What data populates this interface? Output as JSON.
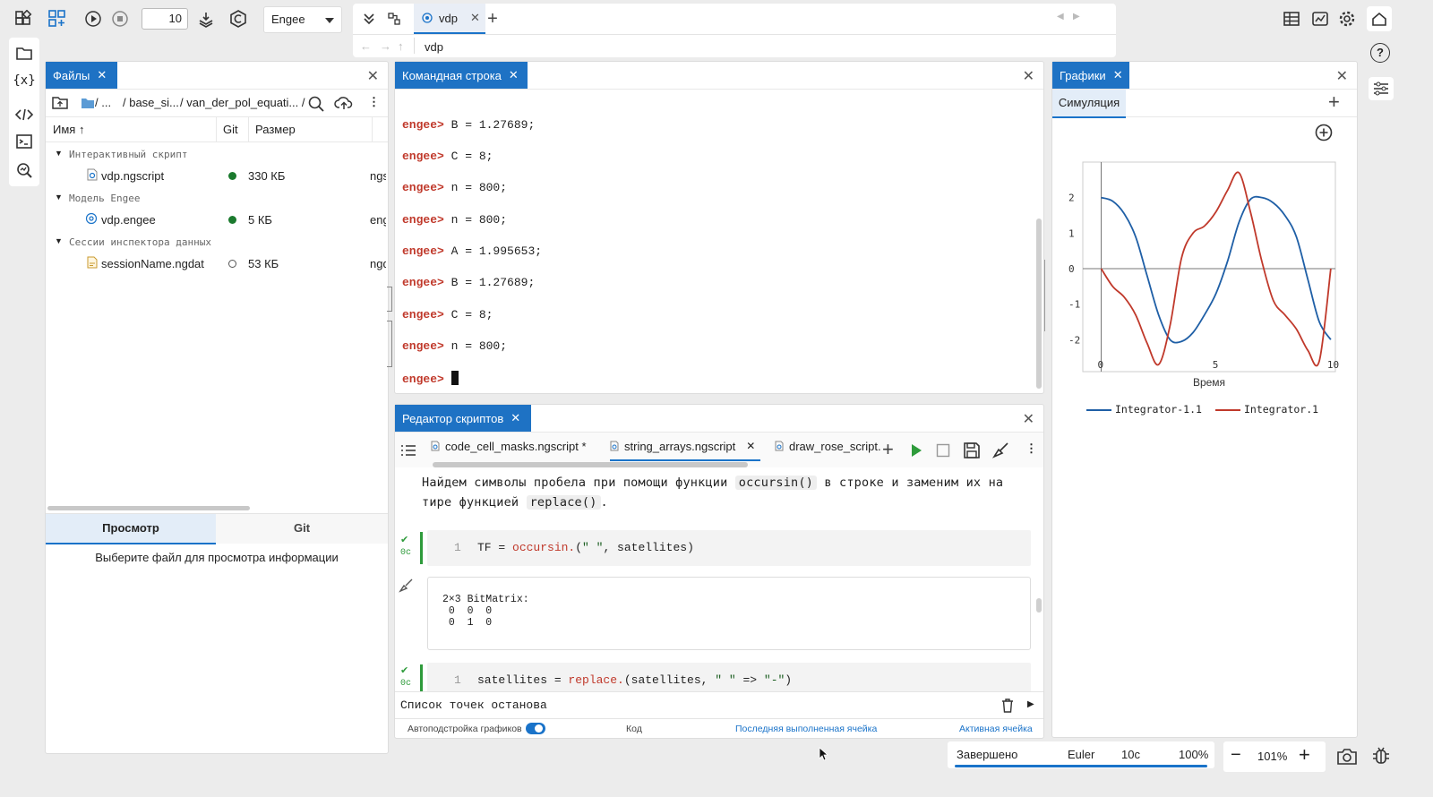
{
  "toolbar": {
    "step_value": "10",
    "engine": "Engee",
    "doc_tab": "vdp",
    "address": "vdp"
  },
  "files": {
    "tab_label": "Файлы",
    "breadcrumb": [
      "/ ...",
      "/ base_si...",
      "/ van_der_pol_equati... /"
    ],
    "columns": {
      "name": "Имя",
      "git": "Git",
      "size": "Размер"
    },
    "groups": [
      {
        "label": "Интерактивный скрипт",
        "items": [
          {
            "name": "vdp.ngscript",
            "git": "dot",
            "size": "330 КБ",
            "type": "ngs"
          }
        ]
      },
      {
        "label": "Модель Engee",
        "items": [
          {
            "name": "vdp.engee",
            "git": "dot",
            "size": "5 КБ",
            "type": "eng"
          }
        ]
      },
      {
        "label": "Сессии инспектора данных",
        "items": [
          {
            "name": "sessionName.ngdat",
            "git": "ring",
            "size": "53 КБ",
            "type": "ngd"
          }
        ]
      }
    ],
    "preview_tabs": [
      "Просмотр",
      "Git"
    ],
    "preview_hint": "Выберите файл для просмотра информации"
  },
  "console": {
    "tab_label": "Командная строка",
    "prompt": "engee>",
    "lines": [
      "B = 1.27689;",
      "C = 8;",
      "n = 800;",
      "n = 800;",
      "A = 1.995653;",
      "B = 1.27689;",
      "C = 8;",
      "n = 800;",
      ""
    ]
  },
  "editor": {
    "tab_label": "Редактор скриптов",
    "file_tabs": [
      "code_cell_masks.ngscript *",
      "string_arrays.ngscript",
      "draw_rose_script.n"
    ],
    "text_parts": [
      "Найдем символы пробела при помощи функции",
      "occursin()",
      "в строке и заменим их на тире",
      "функцией",
      "replace()",
      "."
    ],
    "cell1": {
      "time": "0с",
      "line_no": "1",
      "code_plain1": "TF = ",
      "code_fn": "occursin.",
      "code_plain2": "(",
      "code_str": "\" \"",
      "code_plain3": ", satellites)"
    },
    "output": [
      "2×3 BitMatrix:",
      " 0  0  0",
      " 0  1  0"
    ],
    "cell2": {
      "time": "0с",
      "line_no": "1",
      "code_plain1": "satellites = ",
      "code_fn": "replace.",
      "code_plain2": "(satellites, ",
      "code_str1": "\" \"",
      "code_arrow": " => ",
      "code_str2": "\"-\"",
      "code_plain3": ")"
    },
    "breakpoints_label": "Список точек останова",
    "footer": {
      "auto_label": "Автоподстройка графиков",
      "code_label": "Код",
      "last_cell": "Последняя выполненная ячейка",
      "active_cell": "Активная ячейка"
    }
  },
  "plots": {
    "tab_label": "Графики",
    "sub_tab": "Симуляция",
    "xlabel": "Время",
    "colors": {
      "integrator_1_1": "#1f5fa6",
      "integrator_1": "#c0392b"
    }
  },
  "chart_data": {
    "type": "line",
    "xlabel": "Время",
    "x_ticks": [
      "0",
      "5",
      "10"
    ],
    "y_ticks": [
      "2",
      "1",
      "0",
      "-1",
      "-2"
    ],
    "xlim": [
      -0.8,
      10.2
    ],
    "ylim": [
      -2.9,
      3.0
    ],
    "series": [
      {
        "name": "Integrator-1.1",
        "color": "#1f5fa6",
        "x": [
          0,
          0.5,
          1,
          1.5,
          2,
          2.5,
          3,
          3.5,
          4,
          4.5,
          5,
          5.5,
          6,
          6.5,
          7,
          7.5,
          8,
          8.5,
          9,
          9.5,
          10
        ],
        "y": [
          2.0,
          1.9,
          1.55,
          0.9,
          -0.2,
          -1.3,
          -2.0,
          -2.05,
          -1.8,
          -1.3,
          -0.7,
          0.2,
          1.3,
          1.95,
          2.0,
          1.85,
          1.5,
          0.9,
          -0.3,
          -1.5,
          -2.0
        ]
      },
      {
        "name": "Integrator.1",
        "color": "#c0392b",
        "x": [
          0,
          0.5,
          1,
          1.5,
          2,
          2.5,
          3,
          3.5,
          4,
          4.5,
          5,
          5.5,
          6,
          6.5,
          7,
          7.5,
          8,
          8.5,
          9,
          9.5,
          10
        ],
        "y": [
          0.0,
          -0.5,
          -0.8,
          -1.3,
          -2.1,
          -2.7,
          -1.6,
          0.3,
          1.0,
          1.2,
          1.6,
          2.2,
          2.7,
          1.6,
          0.2,
          -0.9,
          -1.3,
          -1.7,
          -2.3,
          -2.6,
          0.0
        ]
      }
    ]
  },
  "status": {
    "state": "Завершено",
    "solver": "Euler",
    "time": "10с",
    "progress": "100%"
  },
  "zoom": {
    "value": "101%"
  }
}
